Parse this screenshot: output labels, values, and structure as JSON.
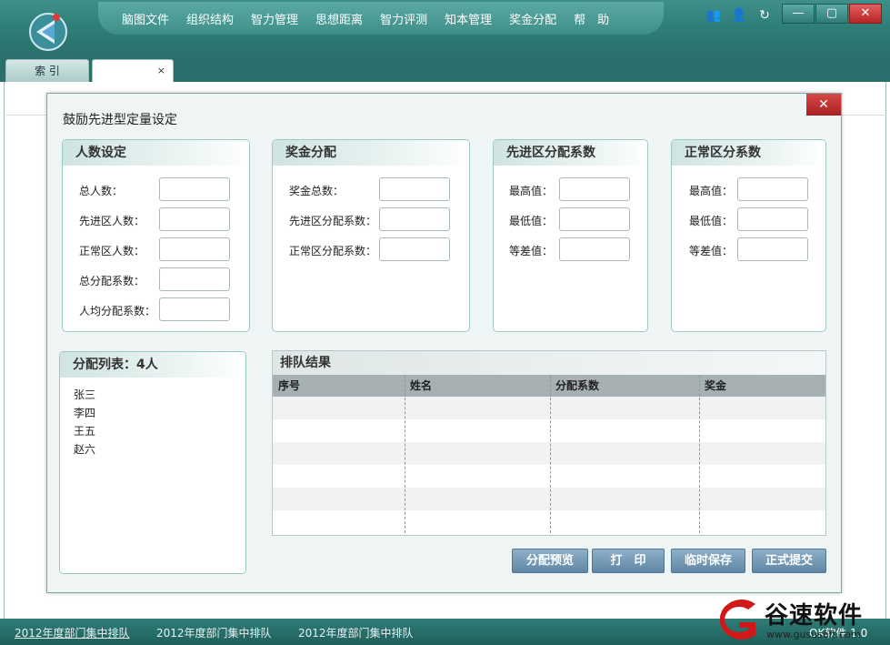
{
  "menu": [
    "脑图文件",
    "组织结构",
    "智力管理",
    "思想距离",
    "智力评测",
    "知本管理",
    "奖金分配",
    "帮　助"
  ],
  "window": {
    "minimize": "—",
    "maximize": "▢",
    "close": "✕"
  },
  "tabs": {
    "index": "索 引",
    "active": "",
    "close": "×"
  },
  "dialog": {
    "title": "鼓励先进型定量设定",
    "close": "✕",
    "groups": {
      "people": {
        "title": "人数设定",
        "labels": [
          "总人数：",
          "先进区人数：",
          "正常区人数：",
          "总分配系数：",
          "人均分配系数："
        ]
      },
      "bonus": {
        "title": "奖金分配",
        "labels": [
          "奖金总数：",
          "先进区分配系数：",
          "正常区分配系数："
        ]
      },
      "advanced": {
        "title": "先进区分配系数",
        "labels": [
          "最高值：",
          "最低值：",
          "等差值："
        ]
      },
      "normal": {
        "title": "正常区分系数",
        "labels": [
          "最高值：",
          "最低值：",
          "等差值："
        ]
      }
    },
    "list": {
      "title": "分配列表：4人",
      "items": [
        "张三",
        "李四",
        "王五",
        "赵六"
      ]
    },
    "result": {
      "title": "排队结果",
      "columns": [
        "序号",
        "姓名",
        "分配系数",
        "奖金"
      ]
    },
    "buttons": [
      "分配预览",
      "打　印",
      "临时保存",
      "正式提交"
    ]
  },
  "status": [
    "2012年度部门集中排队",
    "2012年度部门集中排队",
    "2012年度部门集中排队"
  ],
  "version": "OK软件 1.0",
  "watermark": {
    "brand": "谷速软件",
    "url": "www.gususoft.com"
  },
  "colors": {
    "title_bar": "#2f7f79",
    "button": "#6f95b2",
    "close": "#c03030"
  }
}
